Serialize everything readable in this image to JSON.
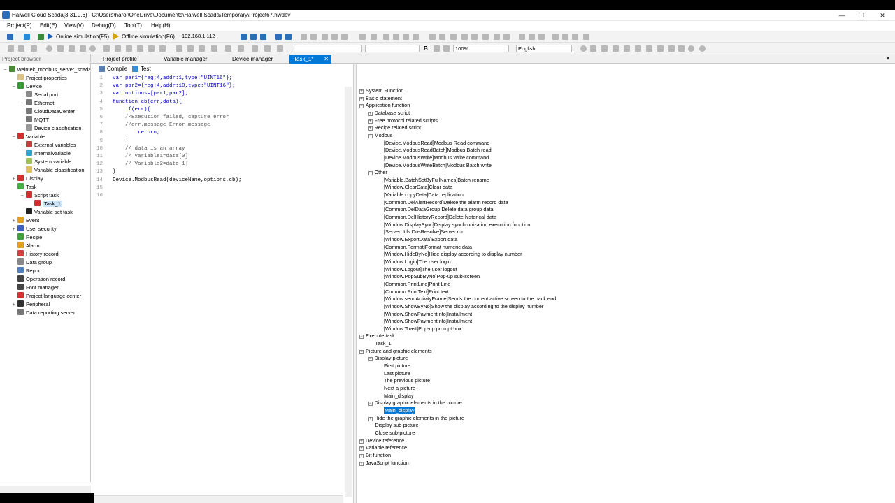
{
  "titlebar": {
    "title": "Haiwell Cloud Scada[3.31.0.6] - C:\\Users\\harol\\OneDrive\\Documents\\Haiwell Scada\\Temporary\\Project67.hwdev",
    "min": "—",
    "restore": "❐",
    "close": "✕"
  },
  "menu": [
    "Project(P)",
    "Edit(E)",
    "View(V)",
    "Debug(D)",
    "Tool(T)",
    "Help(H)"
  ],
  "toolbar": {
    "online": "Online simulation(F5)",
    "offline": "Offline simulation(F6)",
    "ip": "192.168.1.112",
    "fontsize": "B",
    "zoom": "100%",
    "language": "English"
  },
  "tabs": {
    "project_browser": "Project browser",
    "project_profile": "Project profile",
    "variable_manager": "Variable manager",
    "device_manager": "Device manager",
    "task": "Task_1*",
    "task_close": "✕"
  },
  "tree": [
    {
      "label": "weintek_modbus_server_scada",
      "level": 0,
      "tog": "−",
      "color": "#4c8a3a"
    },
    {
      "label": "Project properties",
      "level": 1,
      "tog": "",
      "color": "#d9c089"
    },
    {
      "label": "Device",
      "level": 1,
      "tog": "−",
      "color": "#3a9a3a"
    },
    {
      "label": "Serial port",
      "level": 2,
      "tog": "",
      "color": "#888"
    },
    {
      "label": "Ethernet",
      "level": 2,
      "tog": "+",
      "color": "#777"
    },
    {
      "label": "CloudDataCenter",
      "level": 2,
      "tog": "",
      "color": "#777"
    },
    {
      "label": "MQTT",
      "level": 2,
      "tog": "",
      "color": "#777"
    },
    {
      "label": "Device classification",
      "level": 2,
      "tog": "",
      "color": "#999"
    },
    {
      "label": "Variable",
      "level": 1,
      "tog": "−",
      "color": "#d03030"
    },
    {
      "label": "External variables",
      "level": 2,
      "tog": "+",
      "color": "#c04040"
    },
    {
      "label": "InternalVariable",
      "level": 2,
      "tog": "",
      "color": "#2aa7c9"
    },
    {
      "label": "System variable",
      "level": 2,
      "tog": "",
      "color": "#a0c060"
    },
    {
      "label": "Variable classification",
      "level": 2,
      "tog": "",
      "color": "#e0c060"
    },
    {
      "label": "Display",
      "level": 1,
      "tog": "+",
      "color": "#d03030"
    },
    {
      "label": "Task",
      "level": 1,
      "tog": "−",
      "color": "#40b040"
    },
    {
      "label": "Script task",
      "level": 2,
      "tog": "−",
      "color": "#d03030"
    },
    {
      "label": "Task_1",
      "level": 3,
      "tog": "",
      "color": "#d03030"
    },
    {
      "label": "Variable set task",
      "level": 2,
      "tog": "",
      "color": "#222"
    },
    {
      "label": "Event",
      "level": 1,
      "tog": "+",
      "color": "#e0a020"
    },
    {
      "label": "User security",
      "level": 1,
      "tog": "+",
      "color": "#4060c0"
    },
    {
      "label": "Recipe",
      "level": 1,
      "tog": "",
      "color": "#40a040"
    },
    {
      "label": "Alarm",
      "level": 1,
      "tog": "",
      "color": "#e0a020"
    },
    {
      "label": "History record",
      "level": 1,
      "tog": "",
      "color": "#d04040"
    },
    {
      "label": "Data group",
      "level": 1,
      "tog": "",
      "color": "#888"
    },
    {
      "label": "Report",
      "level": 1,
      "tog": "",
      "color": "#5080c0"
    },
    {
      "label": "Operation record",
      "level": 1,
      "tog": "",
      "color": "#444"
    },
    {
      "label": "Font manager",
      "level": 1,
      "tog": "",
      "color": "#444"
    },
    {
      "label": "Project language center",
      "level": 1,
      "tog": "",
      "color": "#d03030"
    },
    {
      "label": "Peripheral",
      "level": 1,
      "tog": "+",
      "color": "#333"
    },
    {
      "label": "Data reporting server",
      "level": 1,
      "tog": "",
      "color": "#777"
    }
  ],
  "editor": {
    "compile": "Compile",
    "test": "Test",
    "lines": [
      {
        "n": "1",
        "t": "var par1={reg:4,addr:1,type:\"UINT16\"};"
      },
      {
        "n": "2",
        "t": "var par2={reg:4,addr:10,type:\"UINT16\"};"
      },
      {
        "n": "3",
        "t": "var options=[par1,par2];"
      },
      {
        "n": "4",
        "t": "function cb(err,data){"
      },
      {
        "n": "5",
        "t": "    if(err){"
      },
      {
        "n": "6",
        "t": "    //Execution failed, capture error"
      },
      {
        "n": "7",
        "t": "    //err.message Error message"
      },
      {
        "n": "8",
        "t": "        return;"
      },
      {
        "n": "9",
        "t": "    }"
      },
      {
        "n": "10",
        "t": "    // data is an array"
      },
      {
        "n": "11",
        "t": "    // Variable1=data[0]"
      },
      {
        "n": "12",
        "t": "    // Variable2=data[1]"
      },
      {
        "n": "13",
        "t": "}"
      },
      {
        "n": "14",
        "t": "Device.ModbusRead(deviceName,options,cb);"
      },
      {
        "n": "15",
        "t": ""
      },
      {
        "n": "16",
        "t": ""
      }
    ]
  },
  "functions": [
    {
      "label": "System Function",
      "level": 0,
      "tog": "+"
    },
    {
      "label": "Basic statement",
      "level": 0,
      "tog": "+"
    },
    {
      "label": "Application function",
      "level": 0,
      "tog": "−"
    },
    {
      "label": "Database script",
      "level": 1,
      "tog": "+"
    },
    {
      "label": "Free protocol related scripts",
      "level": 1,
      "tog": "+"
    },
    {
      "label": "Recipe related script",
      "level": 1,
      "tog": "+"
    },
    {
      "label": "Modbus",
      "level": 1,
      "tog": "−"
    },
    {
      "label": "[Device.ModbusRead]Modbus Read command",
      "level": 2,
      "tog": ""
    },
    {
      "label": "[Device.ModbusReadBatch]Modbus Batch read",
      "level": 2,
      "tog": ""
    },
    {
      "label": "[Device.ModbusWrite]Modbus Write command",
      "level": 2,
      "tog": ""
    },
    {
      "label": "[Device.ModbusWriteBatch]Modbus Batch write",
      "level": 2,
      "tog": ""
    },
    {
      "label": "Other",
      "level": 1,
      "tog": "−"
    },
    {
      "label": "[Variable.BatchSetByFullNames]Batch rename",
      "level": 2,
      "tog": ""
    },
    {
      "label": "[Window.ClearData]Clear data",
      "level": 2,
      "tog": ""
    },
    {
      "label": "[Variable.copyData]Data replication",
      "level": 2,
      "tog": ""
    },
    {
      "label": "[Common.DelAlertRecord]Delete the alarm record data",
      "level": 2,
      "tog": ""
    },
    {
      "label": "[Common.DelDataGroup]Delete data group data",
      "level": 2,
      "tog": ""
    },
    {
      "label": "[Common.DelHistoryRecord]Delete historical data",
      "level": 2,
      "tog": ""
    },
    {
      "label": "[Window.DisplaySync]Display synchronization execution function",
      "level": 2,
      "tog": ""
    },
    {
      "label": "[ServerUtils.DnsResolve]Server run",
      "level": 2,
      "tog": ""
    },
    {
      "label": "[Window.ExportData]Export data",
      "level": 2,
      "tog": ""
    },
    {
      "label": "[Common.Format]Format numeric data",
      "level": 2,
      "tog": ""
    },
    {
      "label": "[Window.HideByNo]Hide display according to display number",
      "level": 2,
      "tog": ""
    },
    {
      "label": "[Window.Login]The user login",
      "level": 2,
      "tog": ""
    },
    {
      "label": "[Window.Logout]The user logout",
      "level": 2,
      "tog": ""
    },
    {
      "label": "[Window.PopSubByNo]Pop-up sub-screen",
      "level": 2,
      "tog": ""
    },
    {
      "label": "[Common.PrintLine]Print Line",
      "level": 2,
      "tog": ""
    },
    {
      "label": "[Common.PrintText]Print text",
      "level": 2,
      "tog": ""
    },
    {
      "label": "[Window.sendActivityFrame]Sends the current active screen to the back end",
      "level": 2,
      "tog": ""
    },
    {
      "label": "[Window.ShowByNo]Show the display according to the display number",
      "level": 2,
      "tog": ""
    },
    {
      "label": "[Window.ShowPaymentInfo]Installment",
      "level": 2,
      "tog": ""
    },
    {
      "label": "[Window.ShowPaymentInfo]Installment",
      "level": 2,
      "tog": ""
    },
    {
      "label": "[Window.Toast]Pop-up prompt box",
      "level": 2,
      "tog": ""
    },
    {
      "label": "Execute task",
      "level": 0,
      "tog": "−"
    },
    {
      "label": "Task_1",
      "level": 1,
      "tog": ""
    },
    {
      "label": "Picture and graphic elements",
      "level": 0,
      "tog": "−"
    },
    {
      "label": "Display picture",
      "level": 1,
      "tog": "−"
    },
    {
      "label": "First picture",
      "level": 2,
      "tog": ""
    },
    {
      "label": "Last picture",
      "level": 2,
      "tog": ""
    },
    {
      "label": "The previous picture",
      "level": 2,
      "tog": ""
    },
    {
      "label": "Next a picture",
      "level": 2,
      "tog": ""
    },
    {
      "label": "Main_display",
      "level": 2,
      "tog": ""
    },
    {
      "label": "Display graphic elements in the picture",
      "level": 1,
      "tog": "−"
    },
    {
      "label": "Main_display",
      "level": 2,
      "tog": "",
      "selected": true
    },
    {
      "label": "Hide the graphic elements in the picture",
      "level": 1,
      "tog": "+"
    },
    {
      "label": "Display sub-picture",
      "level": 1,
      "tog": ""
    },
    {
      "label": "Close sub-picture",
      "level": 1,
      "tog": ""
    },
    {
      "label": "Device reference",
      "level": 0,
      "tog": "+"
    },
    {
      "label": "Variable reference",
      "level": 0,
      "tog": "+"
    },
    {
      "label": "Bit function",
      "level": 0,
      "tog": "+"
    },
    {
      "label": "JavaScript function",
      "level": 0,
      "tog": "+"
    }
  ]
}
